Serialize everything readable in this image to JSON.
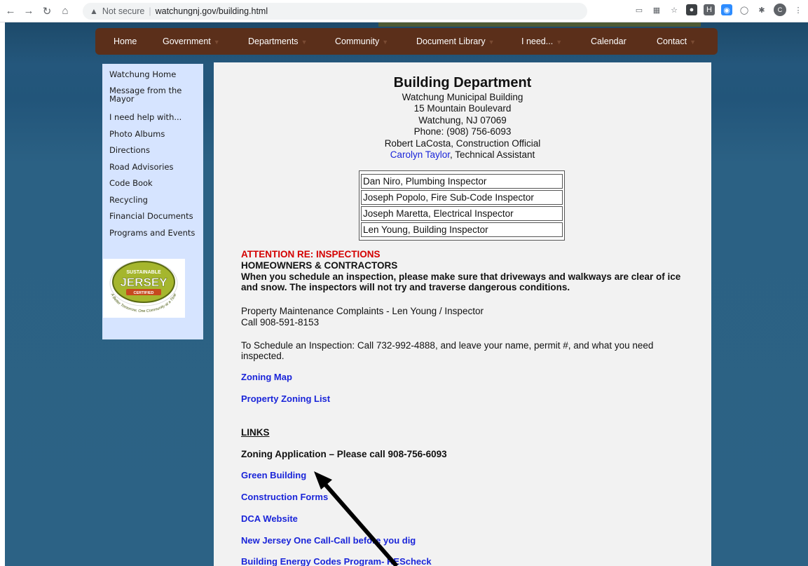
{
  "browser": {
    "security_label": "Not secure",
    "url": "watchungnj.gov/building.html"
  },
  "navbar": {
    "items": [
      {
        "label": "Home"
      },
      {
        "label": "Government"
      },
      {
        "label": "Departments"
      },
      {
        "label": "Community"
      },
      {
        "label": "Document Library"
      },
      {
        "label": "I need..."
      },
      {
        "label": "Calendar"
      },
      {
        "label": "Contact"
      }
    ]
  },
  "sidebar": {
    "items": [
      {
        "label": "Watchung Home"
      },
      {
        "label": "Message from the Mayor"
      },
      {
        "label": "I need help with..."
      },
      {
        "label": "Photo Albums"
      },
      {
        "label": "Directions"
      },
      {
        "label": "Road Advisories"
      },
      {
        "label": "Code Book"
      },
      {
        "label": "Recycling"
      },
      {
        "label": "Financial Documents"
      },
      {
        "label": "Programs and Events"
      }
    ],
    "logo": {
      "top": "SUSTAINABLE",
      "main": "JERSEY",
      "badge": "CERTIFIED",
      "ring": "A Better Tomorrow, One Community at a Time"
    }
  },
  "main": {
    "title": "Building Department",
    "address": [
      "Watchung Municipal Building",
      "15 Mountain Boulevard",
      "Watchung, NJ 07069",
      "Phone:  (908) 756-6093",
      "Robert LaCosta, Construction Official"
    ],
    "assistant_name": "Carolyn Taylor",
    "assistant_title": ", Technical Assistant",
    "staff": [
      "Dan Niro, Plumbing Inspector",
      "Joseph Popolo, Fire Sub-Code Inspector",
      "Joseph Maretta, Electrical Inspector",
      "Len Young, Building Inspector"
    ],
    "attention": "ATTENTION RE: INSPECTIONS",
    "audience": "HOMEOWNERS & CONTRACTORS",
    "notice": "When you schedule an inspection, please make sure that driveways and walkways are clear of ice and snow. The inspectors will not try and traverse dangerous conditions.",
    "complaints_line1": "Property Maintenance Complaints - Len Young / Inspector",
    "complaints_line2": "Call 908-591-8153",
    "schedule": "To Schedule an Inspection: Call 732-992-4888, and leave your name, permit #, and what you need inspected.",
    "zoning_map": "Zoning Map",
    "property_zoning": "Property Zoning List",
    "links_heading": "LINKS",
    "zoning_application": "Zoning Application – Please call 908-756-6093",
    "links": [
      "Green Building",
      "Construction Forms",
      "DCA Website",
      "New Jersey One Call-Call before you dig",
      "Building Energy Codes Program- REScheck"
    ]
  }
}
